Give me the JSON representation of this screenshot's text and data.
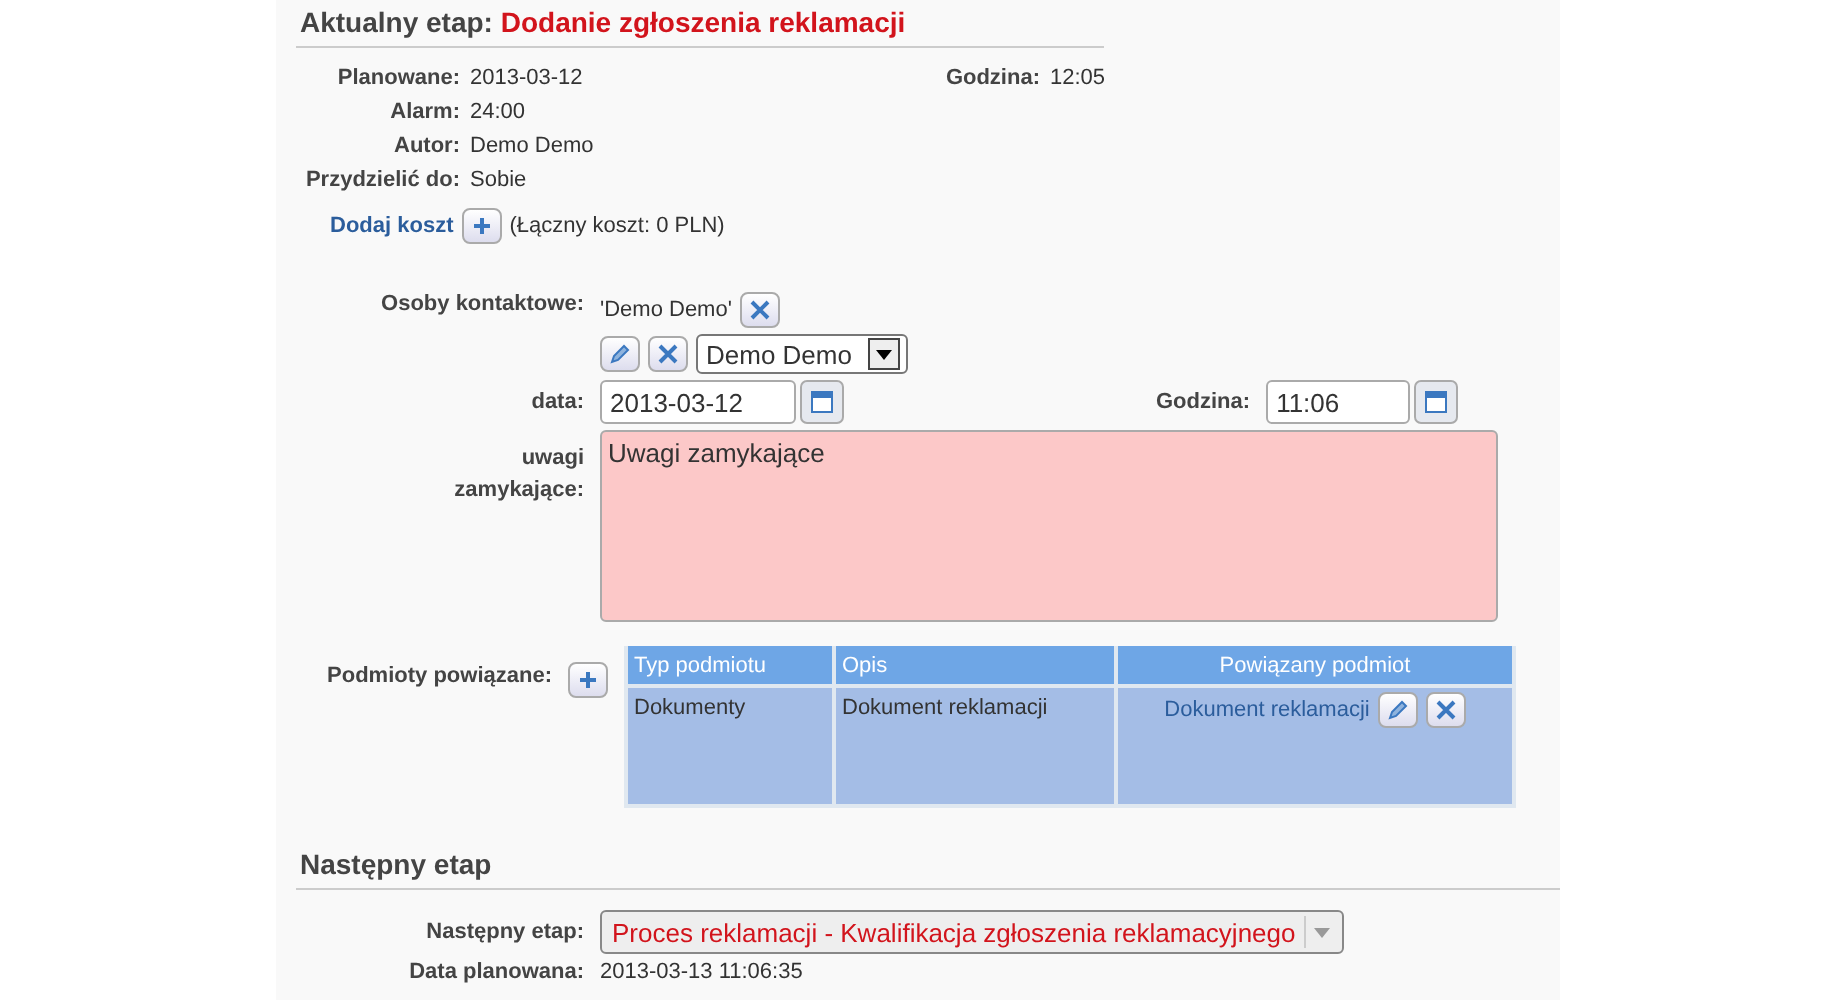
{
  "current_stage": {
    "label": "Aktualny etap:",
    "name": "Dodanie zgłoszenia reklamacji"
  },
  "details": [
    {
      "label": "Planowane:",
      "value": "2013-03-12",
      "extra_label": "Godzina:",
      "extra_value": "12:05"
    },
    {
      "label": "Alarm:",
      "value": "24:00"
    },
    {
      "label": "Autor:",
      "value": "Demo Demo"
    },
    {
      "label": "Przydzielić do:",
      "value": "Sobie"
    }
  ],
  "cost": {
    "link": "Dodaj koszt",
    "total": "(Łączny koszt: 0 PLN)"
  },
  "contacts": {
    "label": "Osoby kontaktowe:",
    "selected_name": "'Demo Demo'",
    "select_value": "Demo Demo"
  },
  "date": {
    "label": "data:",
    "value": "2013-03-12",
    "time_label": "Godzina:",
    "time_value": "11:06"
  },
  "notes": {
    "label": "uwagi zamykające:",
    "value": "Uwagi zamykające"
  },
  "related": {
    "label": "Podmioty powiązane:",
    "columns": [
      "Typ podmiotu",
      "Opis",
      "Powiązany podmiot"
    ],
    "rows": [
      {
        "type": "Dokumenty",
        "description": "Dokument reklamacji",
        "entity": "Dokument reklamacji"
      }
    ]
  },
  "next_stage": {
    "heading": "Następny etap",
    "label": "Następny etap:",
    "value": "Proces reklamacji - Kwalifikacja zgłoszenia reklamacyjnego",
    "planned_label": "Data planowana:",
    "planned_value": "2013-03-13 11:06:35"
  }
}
